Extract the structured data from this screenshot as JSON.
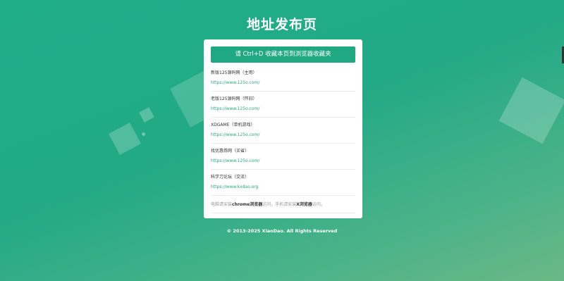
{
  "page": {
    "title": "地址发布页"
  },
  "bookmark_button": {
    "label": "请 Ctrl+D 收藏本页到浏览器收藏夹"
  },
  "sites": [
    {
      "name": "新版125源码网（主用）",
      "url": "https://www.125o.com/"
    },
    {
      "name": "老版125源码网（怀旧）",
      "url": "https://www.125o.com/"
    },
    {
      "name": "XDGAME（单机游戏）",
      "url": "https://www.125o.com/"
    },
    {
      "name": "找优惠券网（买省）",
      "url": "https://www.125o.com/"
    },
    {
      "name": "科学刀论坛（交流）",
      "url": "https://www.kxdao.org"
    }
  ],
  "note": {
    "p1": "电脑请安装",
    "b1": "chrome浏览器",
    "p2": "访问，手机请安装",
    "b2": "X浏览器",
    "p3": "访问。"
  },
  "footer": {
    "text": "© 2013-2025 XiaoDao. All Rights Reserved"
  },
  "colors": {
    "accent": "#1fa882",
    "link": "#2aa883",
    "background_start": "#1fae88",
    "background_end": "#6bb886"
  }
}
